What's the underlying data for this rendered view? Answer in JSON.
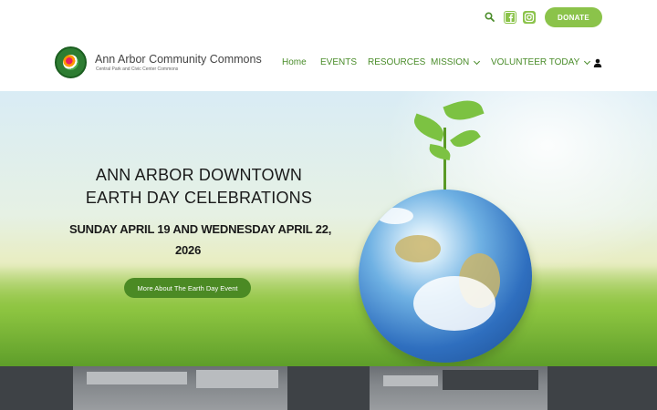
{
  "topbar": {
    "search_icon": "search-icon",
    "social": [
      "facebook-icon",
      "instagram-icon"
    ],
    "donate_label": "DONATE"
  },
  "site": {
    "title": "Ann Arbor Community Commons",
    "tagline": "Central Park and Civic Center Commons",
    "logo": "commons-logo-seal"
  },
  "nav": {
    "items": [
      {
        "label": "Home",
        "has_dropdown": false
      },
      {
        "label": "EVENTS",
        "has_dropdown": false
      },
      {
        "label": "RESOURCES",
        "has_dropdown": false
      },
      {
        "label": "MISSION",
        "has_dropdown": true
      },
      {
        "label": "VOLUNTEER TODAY",
        "has_dropdown": true
      }
    ],
    "account_icon": "user-icon"
  },
  "hero": {
    "heading_line1": "ANN ARBOR DOWNTOWN",
    "heading_line2": "EARTH DAY CELEBRATIONS",
    "date_line1": "SUNDAY APRIL 19 AND WEDNESDAY APRIL 22,",
    "date_line2": "2026",
    "button_label": "More About The Earth Day Event"
  },
  "colors": {
    "accent_green": "#8bc34a",
    "nav_green": "#4a8c2a",
    "button_dark_green": "#4b8a24"
  }
}
